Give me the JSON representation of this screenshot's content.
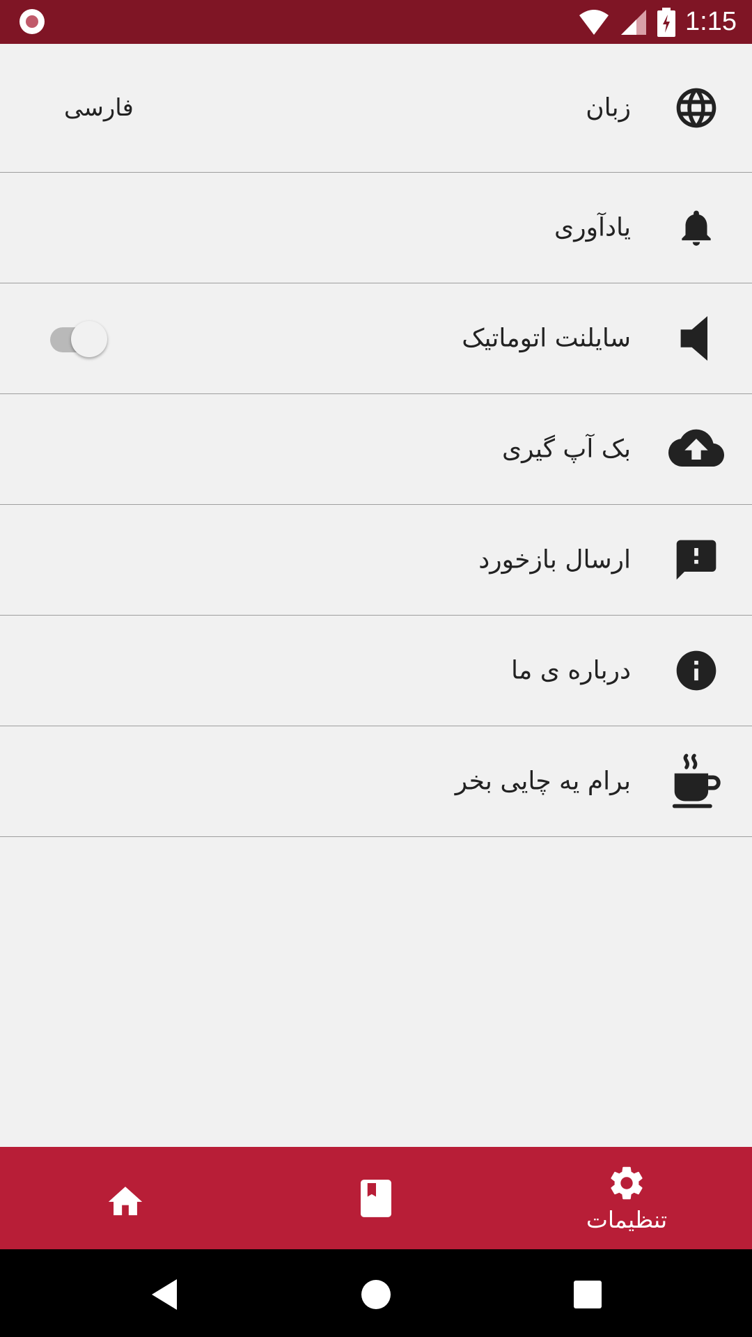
{
  "status_bar": {
    "time": "1:15",
    "icons": [
      "record-icon",
      "wifi-icon",
      "signal-icon",
      "battery-charging-icon"
    ]
  },
  "settings": {
    "items": [
      {
        "icon": "globe-icon",
        "label": "زبان",
        "value": "فارسی"
      },
      {
        "icon": "bell-icon",
        "label": "یادآوری"
      },
      {
        "icon": "volume-mute-icon",
        "label": "سایلنت اتوماتیک",
        "toggle_on": false
      },
      {
        "icon": "cloud-upload-icon",
        "label": "بک آپ گیری"
      },
      {
        "icon": "feedback-icon",
        "label": "ارسال بازخورد"
      },
      {
        "icon": "info-icon",
        "label": "درباره ی ما"
      },
      {
        "icon": "coffee-icon",
        "label": "برام یه چایی بخر"
      }
    ]
  },
  "bottom_nav": {
    "items": [
      {
        "icon": "home-icon",
        "label": ""
      },
      {
        "icon": "book-icon",
        "label": ""
      },
      {
        "icon": "gear-icon",
        "label": "تنظیمات",
        "active": true
      }
    ]
  },
  "colors": {
    "status_bar": "#7f1525",
    "accent": "#b81e37",
    "background": "#f1f1f1",
    "text": "#222222"
  }
}
